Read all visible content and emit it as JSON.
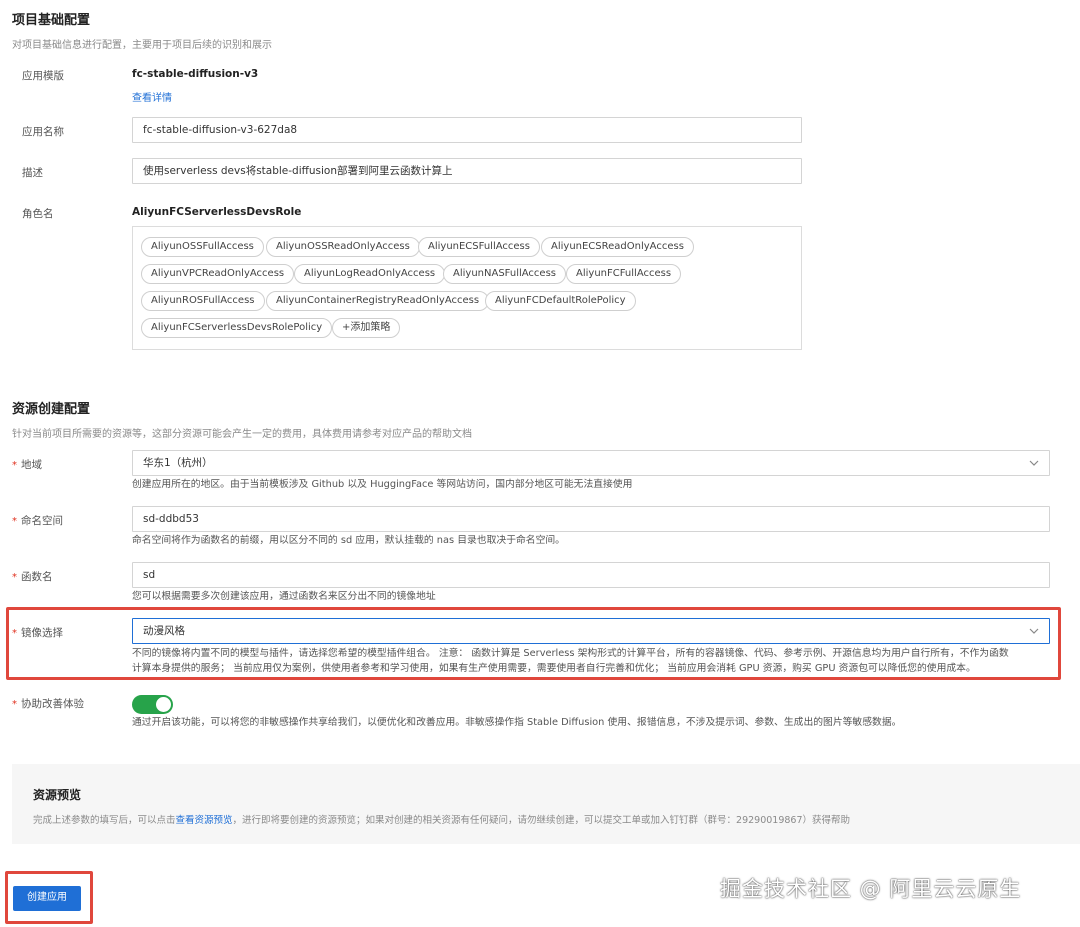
{
  "basic": {
    "title": "项目基础配置",
    "desc": "对项目基础信息进行配置，主要用于项目后续的识别和展示",
    "template_label": "应用模版",
    "template_value": "fc-stable-diffusion-v3",
    "template_link": "查看详情",
    "name_label": "应用名称",
    "name_value": "fc-stable-diffusion-v3-627da8",
    "desc_label": "描述",
    "desc_value": "使用serverless devs将stable-diffusion部署到阿里云函数计算上",
    "role_label": "角色名",
    "role_value": "AliyunFCServerlessDevsRole",
    "policies": [
      "AliyunOSSFullAccess",
      "AliyunOSSReadOnlyAccess",
      "AliyunECSFullAccess",
      "AliyunECSReadOnlyAccess",
      "AliyunVPCReadOnlyAccess",
      "AliyunLogReadOnlyAccess",
      "AliyunNASFullAccess",
      "AliyunFCFullAccess",
      "AliyunROSFullAccess",
      "AliyunContainerRegistryReadOnlyAccess",
      "AliyunFCDefaultRolePolicy",
      "AliyunFCServerlessDevsRolePolicy"
    ],
    "add_policy": "+添加策略"
  },
  "resource": {
    "title": "资源创建配置",
    "desc": "针对当前项目所需要的资源等，这部分资源可能会产生一定的费用，具体费用请参考对应产品的帮助文档",
    "required_mark": "*",
    "region_label": "地域",
    "region_value": "华东1（杭州）",
    "region_help": "创建应用所在的地区。由于当前模板涉及 Github 以及 HuggingFace 等网站访问，国内部分地区可能无法直接使用",
    "ns_label": "命名空间",
    "ns_value": "sd-ddbd53",
    "ns_help": "命名空间将作为函数名的前缀，用以区分不同的 sd 应用，默认挂载的 nas 目录也取决于命名空间。",
    "fn_label": "函数名",
    "fn_value": "sd",
    "fn_help": "您可以根据需要多次创建该应用，通过函数名来区分出不同的镜像地址",
    "image_label": "镜像选择",
    "image_value": "动漫风格",
    "image_help_1": "不同的镜像将内置不同的模型与插件，请选择您希望的模型插件组合。 注意： 函数计算是 Serverless 架构形式的计算平台，所有的容器镜像、代码、参考示例、开源信息均为用户自行所有，不作为函数",
    "image_help_2": "计算本身提供的服务； 当前应用仅为案例，供使用者参考和学习使用，如果有生产使用需要，需要使用者自行完善和优化； 当前应用会消耗 GPU 资源，购买 GPU 资源包可以降低您的使用成本。",
    "improve_label": "协助改善体验",
    "improve_on": true,
    "improve_help": "通过开启该功能，可以将您的非敏感操作共享给我们，以便优化和改善应用。非敏感操作指 Stable Diffusion 使用、报错信息，不涉及提示词、参数、生成出的图片等敏感数据。"
  },
  "preview": {
    "title": "资源预览",
    "text_before": "完成上述参数的填写后，可以点击",
    "link": "查看资源预览",
    "text_after": "，进行即将要创建的资源预览；如果对创建的相关资源有任何疑问，请勿继续创建，可以提交工单或加入钉钉群（群号：29290019867）获得帮助"
  },
  "footer": {
    "create_button": "创建应用",
    "watermark": "掘金技术社区 @ 阿里云云原生"
  },
  "colors": {
    "primary": "#1f6fd6",
    "highlight_border": "#e0473c",
    "toggle_on": "#27a34a"
  }
}
